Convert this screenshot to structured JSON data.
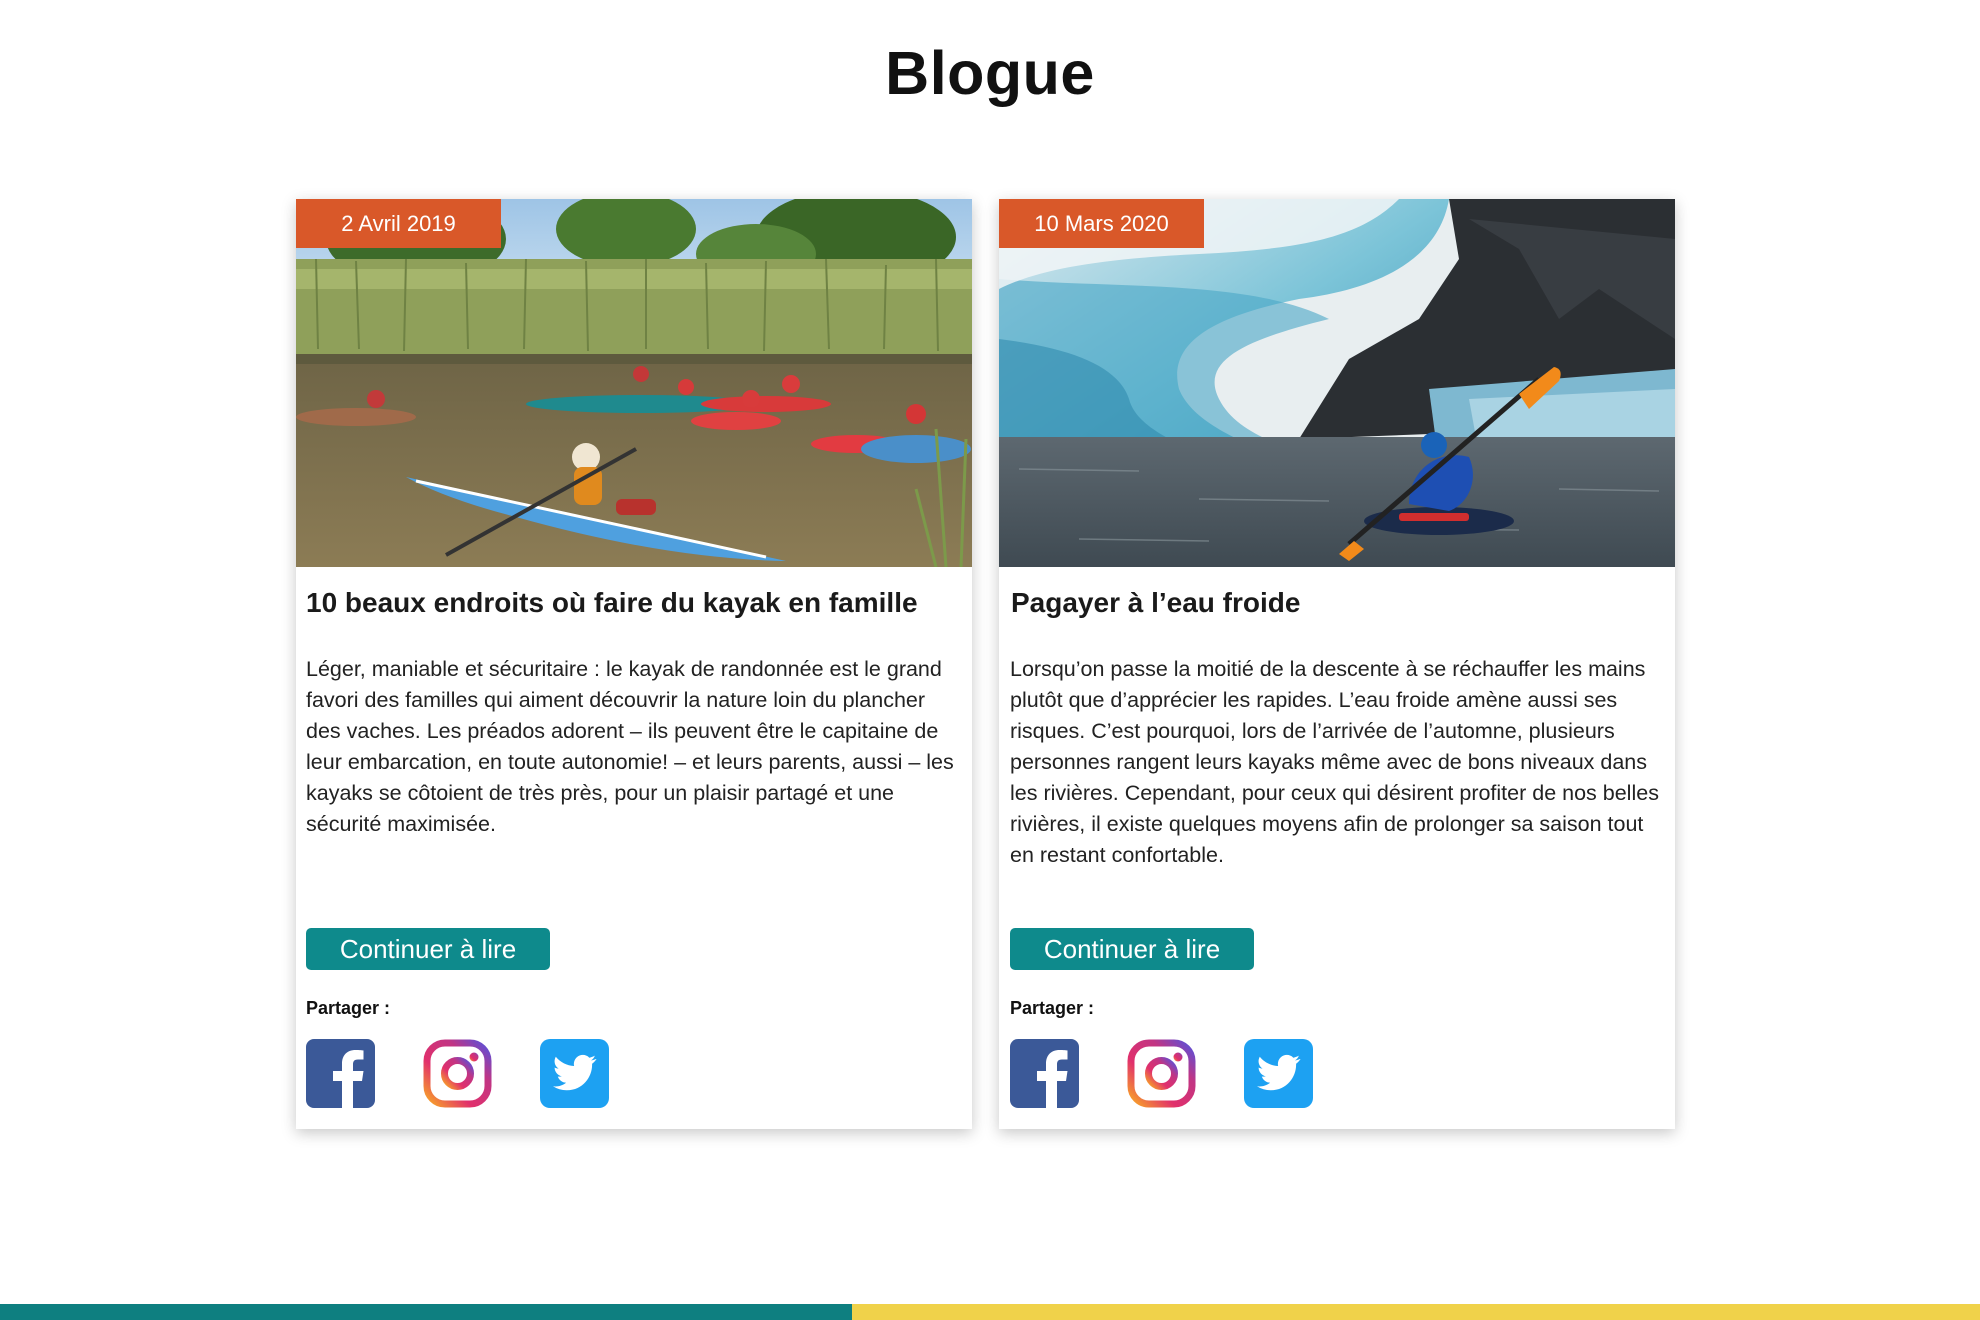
{
  "page": {
    "title": "Blogue"
  },
  "posts": [
    {
      "date": "2 Avril 2019",
      "title": "10 beaux endroits où faire du kayak en famille",
      "excerpt": "Léger, maniable et sécuritaire : le kayak de randonnée est le grand favori des familles qui aiment découvrir la nature loin du plancher des vaches. Les préados adorent – ils peuvent être le capitaine de leur embarcation, en toute autonomie! – et leurs parents, aussi  – les kayaks se côtoient de très près, pour un plaisir partagé et une sécurité maximisée.",
      "read_more_label": "Continuer à lire",
      "share_label": "Partager :",
      "image": "family-kayaking-river-photo",
      "share_icons": [
        "facebook-icon",
        "instagram-icon",
        "twitter-icon"
      ]
    },
    {
      "date": "10 Mars 2020",
      "title": "Pagayer à l’eau froide",
      "excerpt": "Lorsqu’on passe la moitié de la descente à se réchauffer les mains plutôt que d’apprécier les rapides. L’eau froide amène aussi ses risques. C’est pourquoi, lors de l’arrivée de l’automne, plusieurs personnes rangent leurs kayaks même avec de bons niveaux dans les rivières. Cependant, pour ceux qui désirent profiter de nos belles rivières, il existe quelques moyens afin de prolonger sa saison tout en restant confortable.",
      "read_more_label": "Continuer à lire",
      "share_label": "Partager :",
      "image": "kayaker-glacier-photo",
      "share_icons": [
        "facebook-icon",
        "instagram-icon",
        "twitter-icon"
      ]
    }
  ],
  "colors": {
    "date_badge": "#d95829",
    "button": "#0e8a8c",
    "footer_teal": "#0e7f80",
    "footer_yellow": "#f0d24a"
  }
}
